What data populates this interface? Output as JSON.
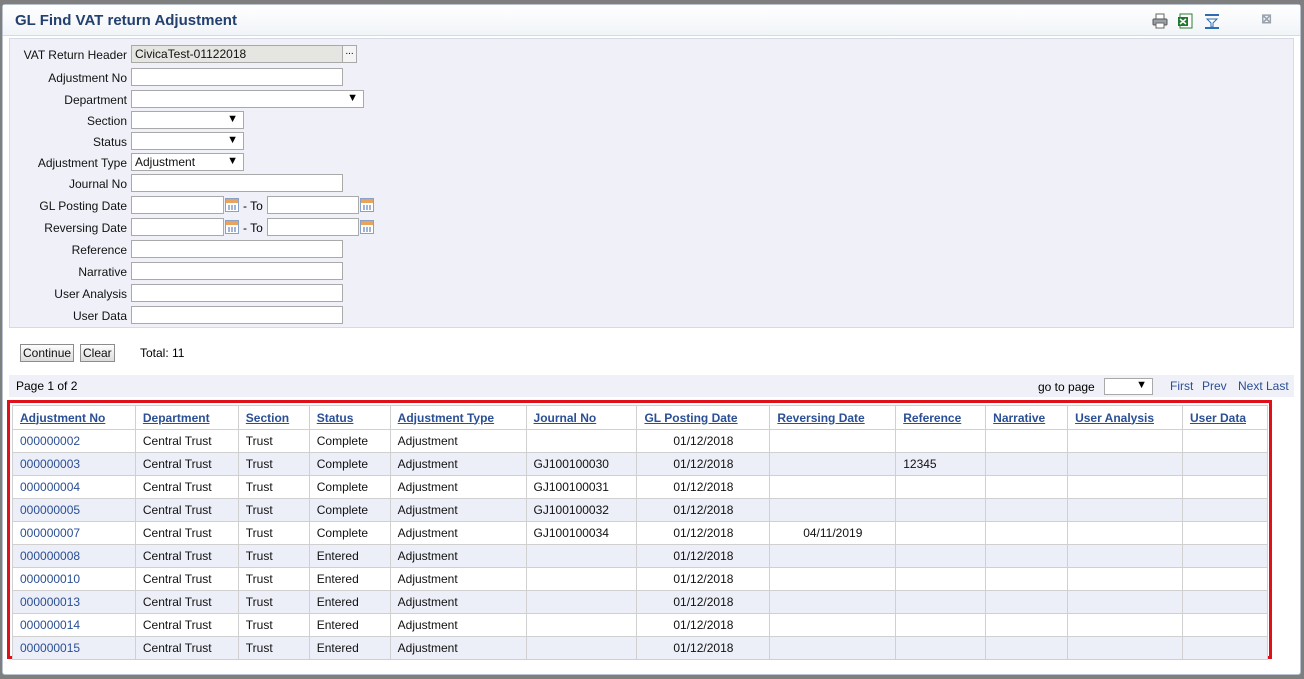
{
  "window": {
    "title": "GL Find VAT return Adjustment"
  },
  "toolbar": {
    "icons": [
      "print-icon",
      "excel-export-icon",
      "filter-icon",
      "close-icon"
    ],
    "close_glyph": "⊠"
  },
  "criteria": {
    "vat_return_header": {
      "label": "VAT Return Header",
      "value": "CivicaTest-01122018",
      "lookup": "..."
    },
    "adjustment_no": {
      "label": "Adjustment No",
      "value": ""
    },
    "department": {
      "label": "Department",
      "value": ""
    },
    "section": {
      "label": "Section",
      "value": ""
    },
    "status": {
      "label": "Status",
      "value": ""
    },
    "adjustment_type": {
      "label": "Adjustment Type",
      "value": "Adjustment"
    },
    "journal_no": {
      "label": "Journal No",
      "value": ""
    },
    "gl_posting_date": {
      "label": "GL Posting Date",
      "to_label": "- To",
      "from": "",
      "to": ""
    },
    "reversing_date": {
      "label": "Reversing Date",
      "to_label": "- To",
      "from": "",
      "to": ""
    },
    "reference": {
      "label": "Reference",
      "value": ""
    },
    "narrative": {
      "label": "Narrative",
      "value": ""
    },
    "user_analysis": {
      "label": "User Analysis",
      "value": ""
    },
    "user_data": {
      "label": "User Data",
      "value": ""
    }
  },
  "actions": {
    "continue_label": "Continue",
    "clear_label": "Clear",
    "total_text": "Total: 11"
  },
  "pager": {
    "page_text": "Page 1 of 2",
    "goto_label": "go to page",
    "goto_value": "",
    "first": "First",
    "prev": "Prev",
    "next": "Next",
    "last": "Last"
  },
  "grid": {
    "columns": [
      "Adjustment No",
      "Department",
      "Section",
      "Status",
      "Adjustment Type",
      "Journal No",
      "GL Posting Date",
      "Reversing Date",
      "Reference",
      "Narrative",
      "User Analysis",
      "User Data"
    ],
    "rows": [
      [
        "000000002",
        "Central Trust",
        "Trust",
        "Complete",
        "Adjustment",
        "",
        "01/12/2018",
        "",
        "",
        "",
        "",
        ""
      ],
      [
        "000000003",
        "Central Trust",
        "Trust",
        "Complete",
        "Adjustment",
        "GJ100100030",
        "01/12/2018",
        "",
        "12345",
        "",
        "",
        ""
      ],
      [
        "000000004",
        "Central Trust",
        "Trust",
        "Complete",
        "Adjustment",
        "GJ100100031",
        "01/12/2018",
        "",
        "",
        "",
        "",
        ""
      ],
      [
        "000000005",
        "Central Trust",
        "Trust",
        "Complete",
        "Adjustment",
        "GJ100100032",
        "01/12/2018",
        "",
        "",
        "",
        "",
        ""
      ],
      [
        "000000007",
        "Central Trust",
        "Trust",
        "Complete",
        "Adjustment",
        "GJ100100034",
        "01/12/2018",
        "04/11/2019",
        "",
        "",
        "",
        ""
      ],
      [
        "000000008",
        "Central Trust",
        "Trust",
        "Entered",
        "Adjustment",
        "",
        "01/12/2018",
        "",
        "",
        "",
        "",
        ""
      ],
      [
        "000000010",
        "Central Trust",
        "Trust",
        "Entered",
        "Adjustment",
        "",
        "01/12/2018",
        "",
        "",
        "",
        "",
        ""
      ],
      [
        "000000013",
        "Central Trust",
        "Trust",
        "Entered",
        "Adjustment",
        "",
        "01/12/2018",
        "",
        "",
        "",
        "",
        ""
      ],
      [
        "000000014",
        "Central Trust",
        "Trust",
        "Entered",
        "Adjustment",
        "",
        "01/12/2018",
        "",
        "",
        "",
        "",
        ""
      ],
      [
        "000000015",
        "Central Trust",
        "Trust",
        "Entered",
        "Adjustment",
        "",
        "01/12/2018",
        "",
        "",
        "",
        "",
        ""
      ]
    ]
  }
}
